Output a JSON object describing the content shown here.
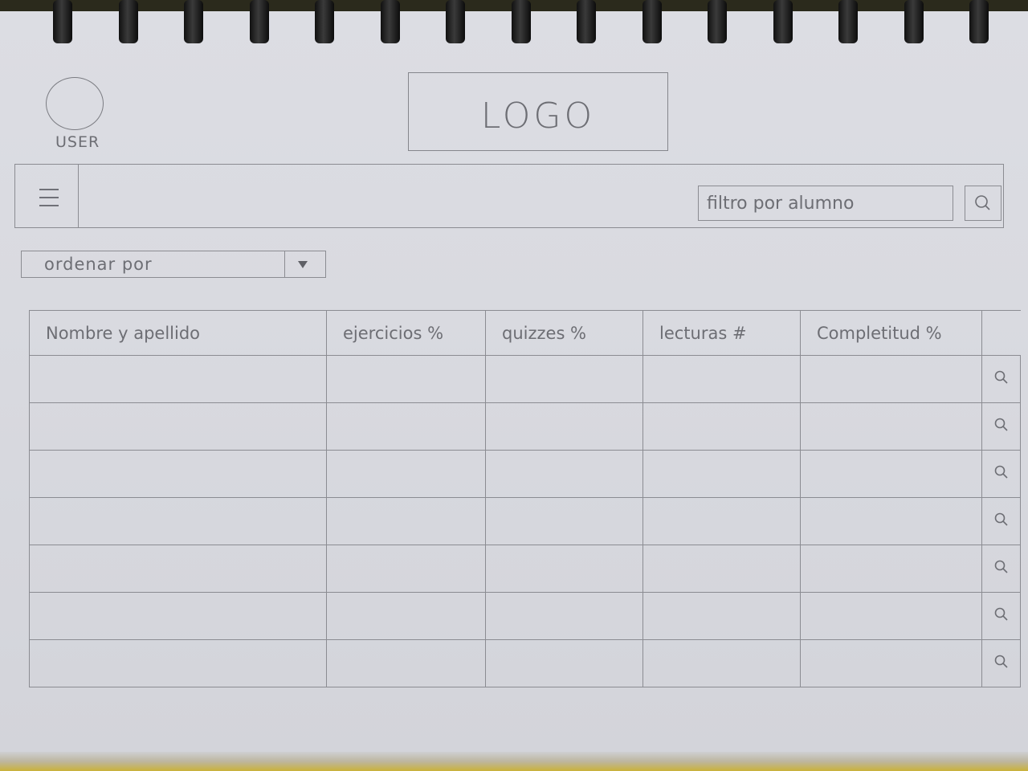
{
  "user": {
    "label": "USER"
  },
  "logo": {
    "text": "LOGO"
  },
  "navbar": {
    "menu_icon": "hamburger-icon",
    "filter_placeholder": "filtro por alumno",
    "search_icon": "search-icon"
  },
  "sort": {
    "label": "ordenar por",
    "arrow_icon": "dropdown-arrow-icon"
  },
  "table": {
    "columns": [
      "Nombre y apellido",
      "ejercicios %",
      "quizzes %",
      "lecturas #",
      "Completitud %"
    ],
    "rows": [
      {
        "cells": [
          "",
          "",
          "",
          "",
          ""
        ],
        "action_icon": "search-icon"
      },
      {
        "cells": [
          "",
          "",
          "",
          "",
          ""
        ],
        "action_icon": "search-icon"
      },
      {
        "cells": [
          "",
          "",
          "",
          "",
          ""
        ],
        "action_icon": "search-icon"
      },
      {
        "cells": [
          "",
          "",
          "",
          "",
          ""
        ],
        "action_icon": "search-icon"
      },
      {
        "cells": [
          "",
          "",
          "",
          "",
          ""
        ],
        "action_icon": "search-icon"
      },
      {
        "cells": [
          "",
          "",
          "",
          "",
          ""
        ],
        "action_icon": "search-icon"
      },
      {
        "cells": [
          "",
          "",
          "",
          "",
          ""
        ],
        "action_icon": "search-icon"
      }
    ]
  }
}
